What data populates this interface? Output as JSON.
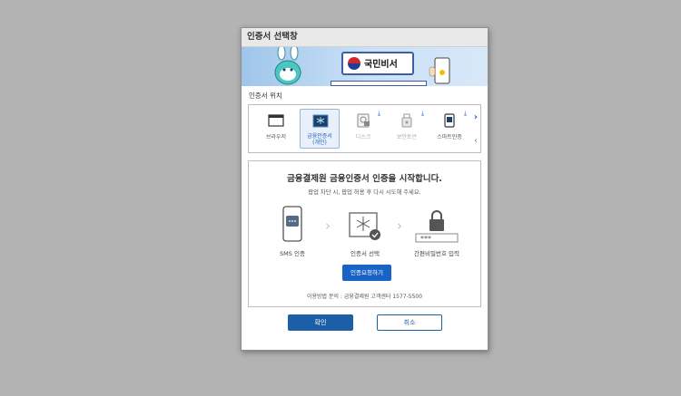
{
  "dialog": {
    "title": "인증서 선택창"
  },
  "banner": {
    "brand": "국민비서"
  },
  "location": {
    "label": "인증서 위치",
    "items": [
      {
        "label": "브라우저",
        "icon": "browser-icon"
      },
      {
        "label": "금융인증서",
        "sublabel": "(개인)",
        "icon": "financial-cert-icon",
        "selected": true
      },
      {
        "label": "디스크",
        "icon": "disk-icon"
      },
      {
        "label": "보안토큰",
        "icon": "security-token-icon"
      },
      {
        "label": "스마트인증",
        "icon": "smart-cert-icon"
      }
    ]
  },
  "main": {
    "title": "금융결제원 금융인증서 인증을 시작합니다.",
    "subtitle": "팝업 차단 시, 팝업 허용 후 다시 시도해 주세요.",
    "steps": [
      {
        "label": "SMS 인증"
      },
      {
        "label": "인증서 선택"
      },
      {
        "label": "간편비밀번호 입력"
      }
    ],
    "request_button": "인증요청하기",
    "contact": "이용방법 문의 : 금융결제원 고객센터 1577-5500"
  },
  "footer": {
    "ok": "확인",
    "cancel": "취소"
  },
  "colors": {
    "accent": "#1a63c6",
    "button_dark": "#1c5ea8"
  }
}
